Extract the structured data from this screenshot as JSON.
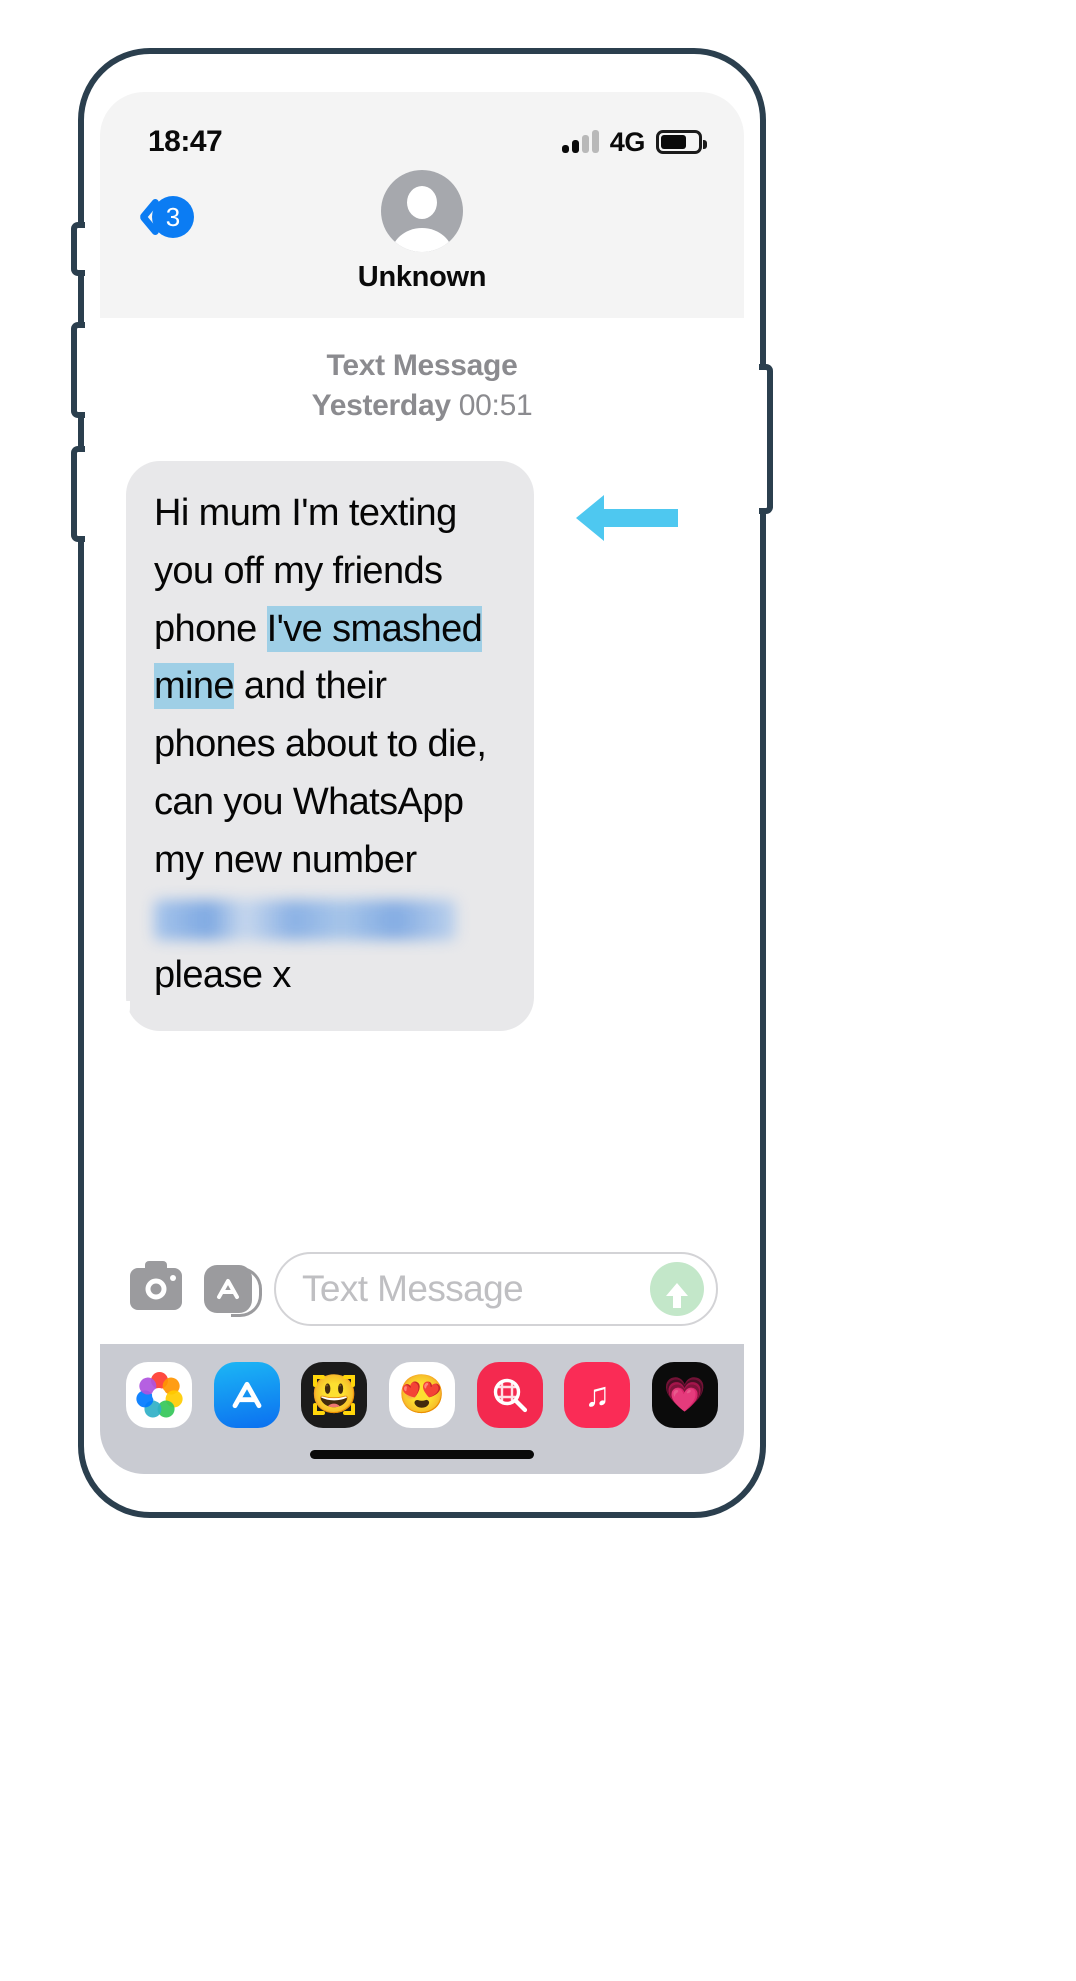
{
  "status_bar": {
    "time": "18:47",
    "carrier_network": "4G",
    "signal_bars_total": 4,
    "signal_bars_active": 2,
    "battery_percent_fill": 70
  },
  "nav": {
    "back_label": "back-chevron",
    "unread_count": "3",
    "contact_name": "Unknown",
    "avatar": "default-person-avatar"
  },
  "conversation": {
    "message_kind": "Text Message",
    "timestamp_day": "Yesterday",
    "timestamp_time": "00:51",
    "bubble": {
      "segment_1": "Hi mum I'm texting you off my friends phone ",
      "highlighted": "I've smashed mine",
      "segment_2": " and their phones about to die, can you WhatsApp my new number",
      "redacted_value": "[phone number redacted]",
      "segment_3": "please x"
    },
    "annotation": {
      "type": "arrow",
      "direction": "left",
      "color": "#4ec8f0",
      "highlight_color": "#9fcfe6"
    }
  },
  "compose": {
    "camera_icon": "camera-icon",
    "appstore_icon": "app-store-icon",
    "placeholder": "Text Message",
    "send_icon": "send-arrow-up-icon"
  },
  "app_tray": {
    "items": [
      {
        "name": "photos",
        "icon": "photos-icon",
        "label": "Photos"
      },
      {
        "name": "app-store",
        "icon": "app-store-icon",
        "label": "App Store"
      },
      {
        "name": "memoji-camera",
        "icon": "memoji-camera-icon",
        "label": "Memoji Camera",
        "glyph": "😃"
      },
      {
        "name": "memoji-stickers",
        "icon": "memoji-stickers-icon",
        "label": "Memoji Stickers",
        "glyph": "😍"
      },
      {
        "name": "images-search",
        "icon": "images-search-icon",
        "label": "#images"
      },
      {
        "name": "apple-music",
        "icon": "music-note-icon",
        "label": "Music",
        "glyph": "♫"
      },
      {
        "name": "digital-touch",
        "icon": "heartbeat-icon",
        "label": "Digital Touch",
        "glyph": "💗"
      }
    ]
  },
  "home_indicator": "home-indicator-bar"
}
